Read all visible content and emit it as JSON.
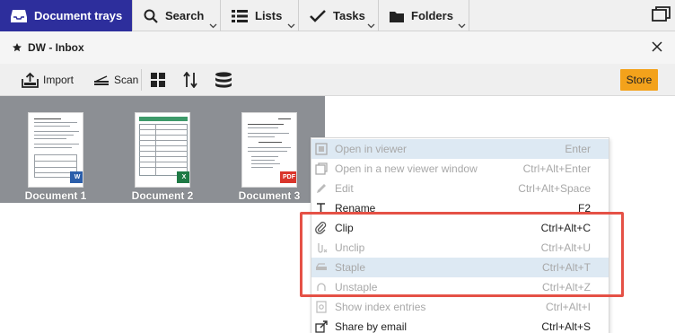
{
  "nav": {
    "tabs": [
      {
        "label": "Document trays",
        "icon": "inbox-tray-icon",
        "active": true
      },
      {
        "label": "Search",
        "icon": "search-icon"
      },
      {
        "label": "Lists",
        "icon": "list-icon"
      },
      {
        "label": "Tasks",
        "icon": "checkmark-icon"
      },
      {
        "label": "Folders",
        "icon": "folder-icon"
      }
    ],
    "window_icon": "window-icon",
    "active_color": "#2d2e9c"
  },
  "tray": {
    "title": "DW - Inbox",
    "close_icon": "close-icon"
  },
  "toolbar": {
    "import_label": "Import",
    "scan_label": "Scan",
    "store_label": "Store",
    "store_color": "#f3a21b"
  },
  "documents": [
    {
      "name": "Document 1",
      "badge": "W",
      "badge_color": "#2b5eaa"
    },
    {
      "name": "Document 2",
      "badge": "X",
      "badge_color": "#1f7a45"
    },
    {
      "name": "Document 3",
      "badge": "PDF",
      "badge_color": "#d9362c"
    }
  ],
  "context_menu": {
    "items": [
      {
        "label": "Open in viewer",
        "shortcut": "Enter",
        "enabled": false,
        "highlighted": true,
        "icon": "viewer-icon"
      },
      {
        "label": "Open in a new viewer window",
        "shortcut": "Ctrl+Alt+Enter",
        "enabled": false,
        "highlighted": false,
        "icon": "new-window-icon"
      },
      {
        "label": "Edit",
        "shortcut": "Ctrl+Alt+Space",
        "enabled": false,
        "highlighted": false,
        "icon": "pencil-icon"
      },
      {
        "label": "Rename",
        "shortcut": "F2",
        "enabled": true,
        "highlighted": false,
        "icon": "rename-icon"
      },
      {
        "label": "Clip",
        "shortcut": "Ctrl+Alt+C",
        "enabled": true,
        "highlighted": false,
        "icon": "paperclip-icon"
      },
      {
        "label": "Unclip",
        "shortcut": "Ctrl+Alt+U",
        "enabled": false,
        "highlighted": false,
        "icon": "unclip-icon"
      },
      {
        "label": "Staple",
        "shortcut": "Ctrl+Alt+T",
        "enabled": false,
        "highlighted": true,
        "icon": "staple-icon"
      },
      {
        "label": "Unstaple",
        "shortcut": "Ctrl+Alt+Z",
        "enabled": false,
        "highlighted": false,
        "icon": "unstaple-icon"
      },
      {
        "label": "Show index entries",
        "shortcut": "Ctrl+Alt+I",
        "enabled": false,
        "highlighted": false,
        "icon": "index-icon"
      },
      {
        "label": "Share by email",
        "shortcut": "Ctrl+Alt+S",
        "enabled": true,
        "highlighted": false,
        "icon": "share-icon"
      }
    ]
  }
}
